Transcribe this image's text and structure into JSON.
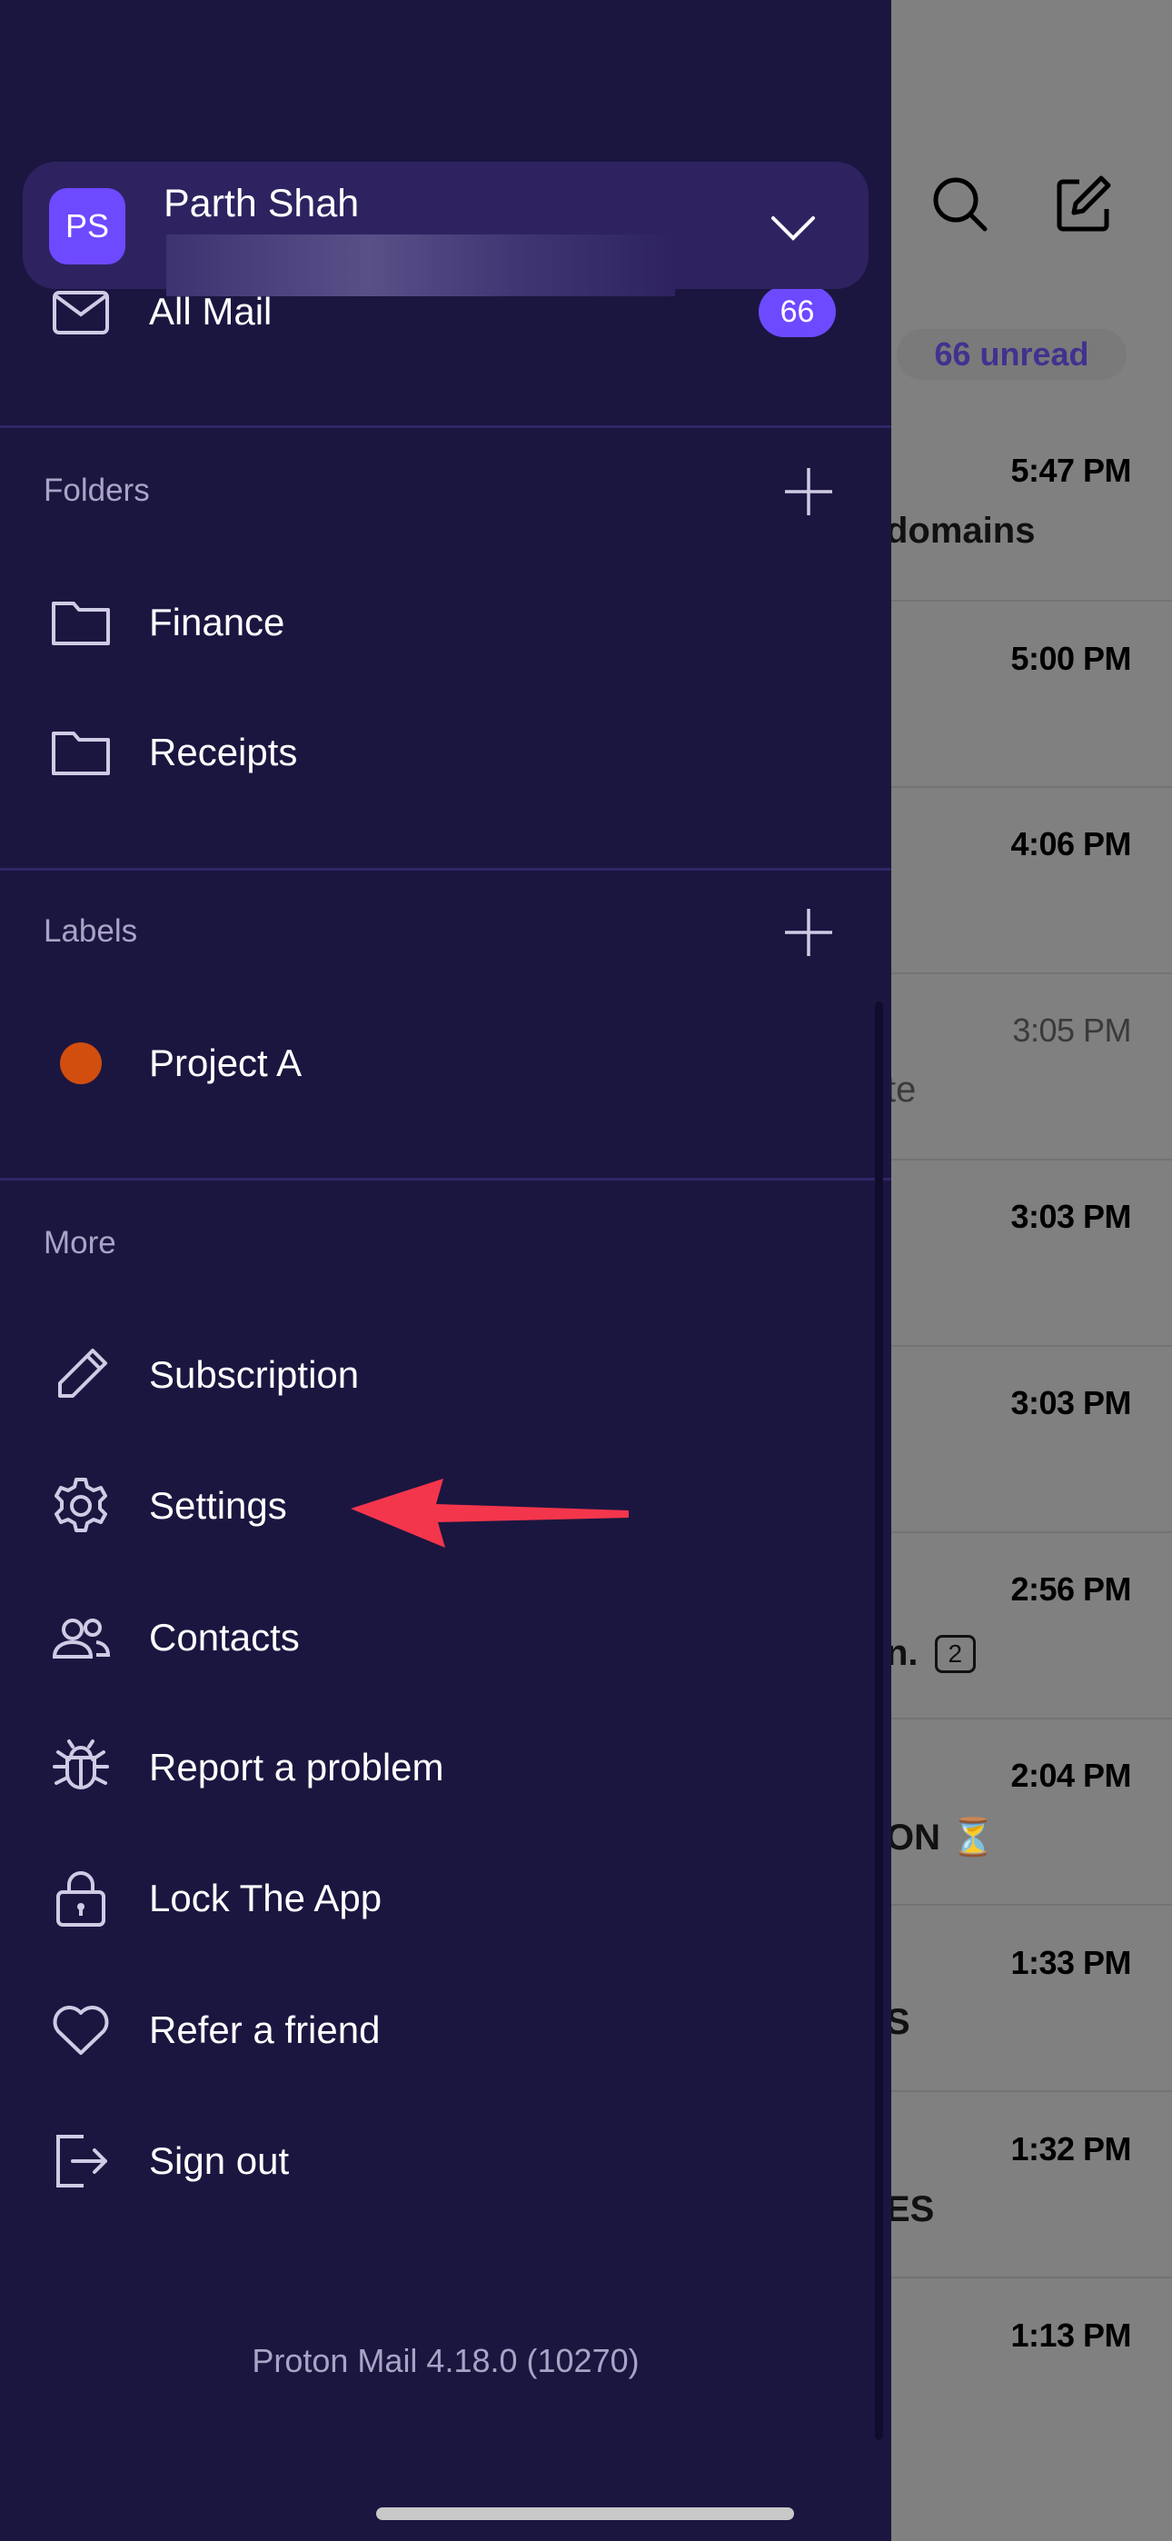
{
  "account": {
    "initials": "PS",
    "name": "Parth Shah",
    "avatar_color": "#6d4aff"
  },
  "all_mail": {
    "label": "All Mail",
    "badge": "66"
  },
  "folders": {
    "title": "Folders",
    "items": [
      {
        "label": "Finance",
        "icon": "folder-icon"
      },
      {
        "label": "Receipts",
        "icon": "folder-icon"
      }
    ]
  },
  "labels": {
    "title": "Labels",
    "items": [
      {
        "label": "Project A",
        "color": "#d14e0e"
      }
    ]
  },
  "more": {
    "title": "More",
    "items": [
      {
        "label": "Subscription",
        "icon": "pencil-icon"
      },
      {
        "label": "Settings",
        "icon": "gear-icon"
      },
      {
        "label": "Contacts",
        "icon": "contacts-icon"
      },
      {
        "label": "Report a problem",
        "icon": "bug-icon"
      },
      {
        "label": "Lock The App",
        "icon": "lock-icon"
      },
      {
        "label": "Refer a friend",
        "icon": "heart-icon"
      },
      {
        "label": "Sign out",
        "icon": "sign-out-icon"
      }
    ]
  },
  "version": "Proton Mail 4.18.0 (10270)",
  "inbox": {
    "unread": "66 unread",
    "times": [
      "5:47 PM",
      "5:00 PM",
      "4:06 PM",
      "3:05 PM",
      "3:03 PM",
      "3:03 PM",
      "2:56 PM",
      "2:04 PM",
      "1:33 PM",
      "1:32 PM",
      "1:13 PM"
    ],
    "snippets": {
      "s0": "domains",
      "s3": "te",
      "s6": "n.",
      "s6_count": "2",
      "s7": "ON ⏳",
      "s8": "S",
      "s9": "ES"
    }
  },
  "colors": {
    "drawer": "#1b1640",
    "accent": "#6d4aff",
    "annotation_arrow": "#f4364c"
  }
}
